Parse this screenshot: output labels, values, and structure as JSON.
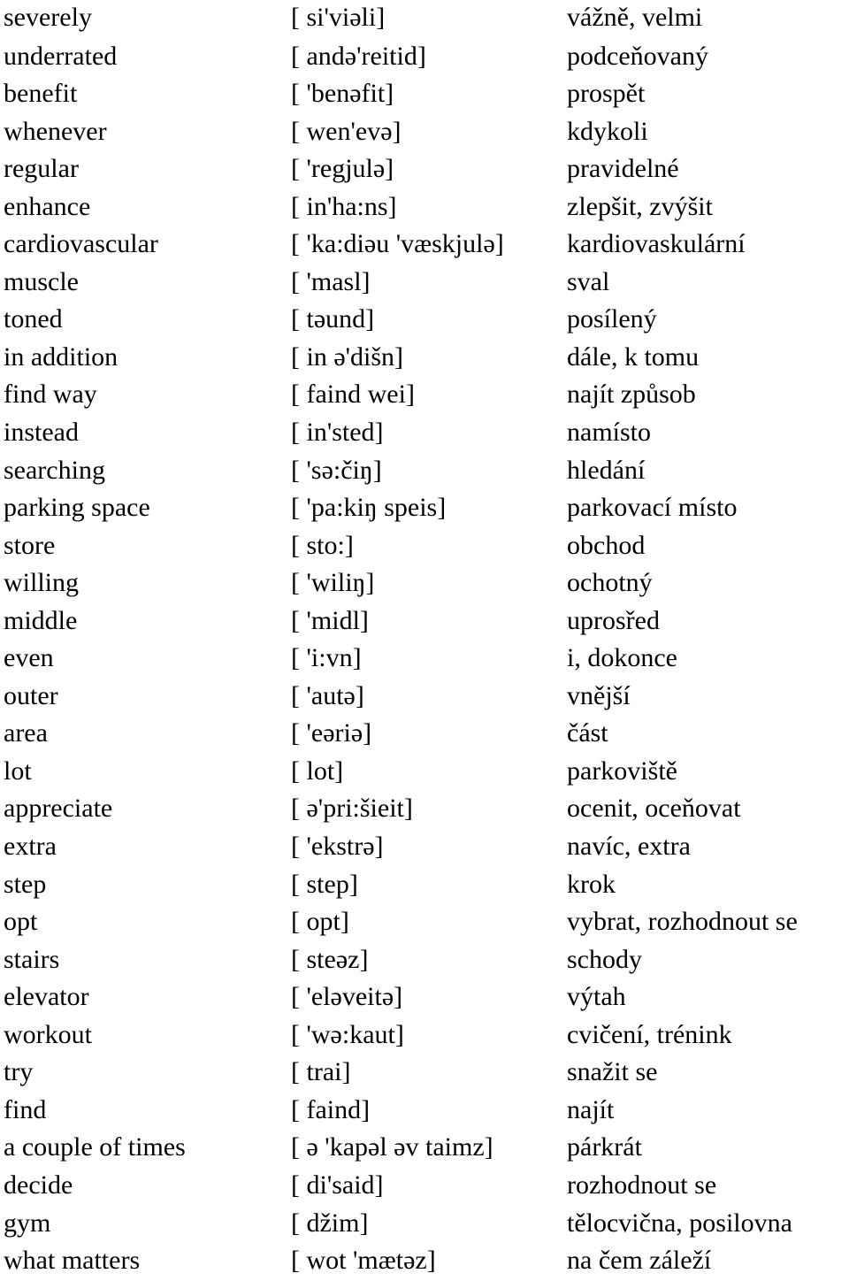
{
  "document": {
    "type": "vocabulary-list",
    "language_pair": "English – Czech",
    "columns": [
      "term",
      "pronunciation",
      "translation"
    ],
    "row_count": 34
  },
  "rows": [
    {
      "term": "severely",
      "ipa": "[ si'viəli]",
      "cz": "vážně, velmi"
    },
    {
      "term": "underrated",
      "ipa": "[ andə'reitid]",
      "cz": "podceňovaný"
    },
    {
      "term": "benefit",
      "ipa": "[ 'benəfit]",
      "cz": "prospět"
    },
    {
      "term": "whenever",
      "ipa": "[ wen'evə]",
      "cz": "kdykoli"
    },
    {
      "term": "regular",
      "ipa": "[ 'regjulə]",
      "cz": "pravidelné"
    },
    {
      "term": "enhance",
      "ipa": "[ in'ha:ns]",
      "cz": "zlepšit, zvýšit"
    },
    {
      "term": "cardiovascular",
      "ipa": "[ 'ka:diəu 'væskjulə]",
      "cz": "kardiovaskulární"
    },
    {
      "term": "muscle",
      "ipa": "[ 'masl]",
      "cz": "sval"
    },
    {
      "term": "toned",
      "ipa": "[ təund]",
      "cz": "posílený"
    },
    {
      "term": "in addition",
      "ipa": "[ in ə'dišn]",
      "cz": "dále, k tomu"
    },
    {
      "term": "find way",
      "ipa": "[ faind wei]",
      "cz": "najít způsob"
    },
    {
      "term": "instead",
      "ipa": "[ in'sted]",
      "cz": "namísto"
    },
    {
      "term": "searching",
      "ipa": "[ 'sə:čiŋ]",
      "cz": "hledání"
    },
    {
      "term": "parking space",
      "ipa": "[ 'pa:kiŋ speis]",
      "cz": "parkovací místo"
    },
    {
      "term": "store",
      "ipa": "[ sto:]",
      "cz": "obchod"
    },
    {
      "term": "willing",
      "ipa": "[ 'wiliŋ]",
      "cz": "ochotný"
    },
    {
      "term": "middle",
      "ipa": "[ 'midl]",
      "cz": "uprosřed"
    },
    {
      "term": "even",
      "ipa": "[ 'i:vn]",
      "cz": "i, dokonce"
    },
    {
      "term": "outer",
      "ipa": "[ 'autə]",
      "cz": "vnější"
    },
    {
      "term": "area",
      "ipa": "[ 'eəriə]",
      "cz": "část"
    },
    {
      "term": "lot",
      "ipa": "[ lot]",
      "cz": "parkoviště"
    },
    {
      "term": "appreciate",
      "ipa": "[ ə'pri:šieit]",
      "cz": "ocenit, oceňovat"
    },
    {
      "term": "extra",
      "ipa": "[ 'ekstrə]",
      "cz": "navíc, extra"
    },
    {
      "term": "step",
      "ipa": "[ step]",
      "cz": "krok"
    },
    {
      "term": "opt",
      "ipa": "[ opt]",
      "cz": "vybrat, rozhodnout se"
    },
    {
      "term": "stairs",
      "ipa": "[ steəz]",
      "cz": "schody"
    },
    {
      "term": "elevator",
      "ipa": "[ 'eləveitə]",
      "cz": "výtah"
    },
    {
      "term": "workout",
      "ipa": "[ 'wə:kaut]",
      "cz": "cvičení, trénink"
    },
    {
      "term": "try",
      "ipa": "[ trai]",
      "cz": "snažit se"
    },
    {
      "term": "find",
      "ipa": "[ faind]",
      "cz": "najít"
    },
    {
      "term": "a couple of times",
      "ipa": "[ ə 'kapəl əv taimz]",
      "cz": "párkrát"
    },
    {
      "term": "decide",
      "ipa": "[ di'said]",
      "cz": "rozhodnout se"
    },
    {
      "term": "gym",
      "ipa": "[ džim]",
      "cz": "tělocvična, posilovna"
    },
    {
      "term": "what matters",
      "ipa": "[ wot 'mætəz]",
      "cz": "na čem záleží"
    }
  ]
}
